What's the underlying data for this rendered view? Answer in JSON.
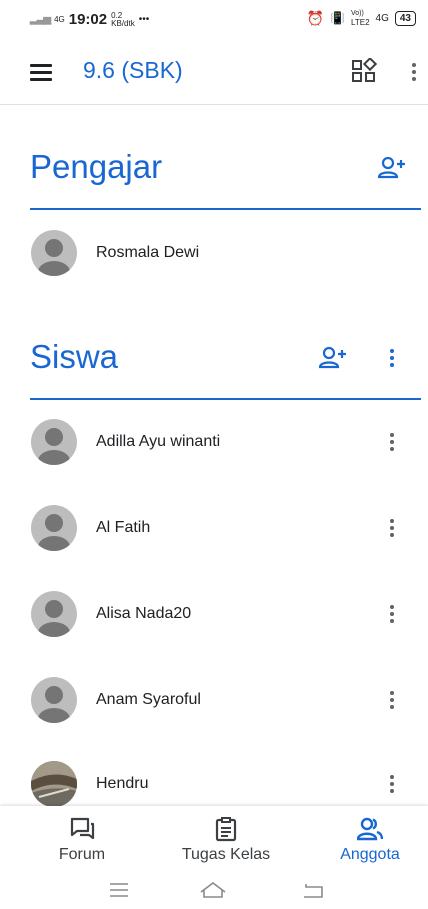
{
  "status_bar": {
    "network_type": "4G",
    "time": "19:02",
    "speed_value": "0.2",
    "speed_unit": "KB/dtk",
    "dots": "•••",
    "volte": "Vo))",
    "lte": "LTE2",
    "network2": "4G",
    "battery": "43"
  },
  "appbar": {
    "title": "9.6 (SBK)"
  },
  "teachers_section": {
    "title": "Pengajar",
    "people": [
      {
        "name": "Rosmala Dewi"
      }
    ]
  },
  "students_section": {
    "title": "Siswa",
    "people": [
      {
        "name": "Adilla Ayu winanti"
      },
      {
        "name": "Al Fatih"
      },
      {
        "name": "Alisa Nada20"
      },
      {
        "name": "Anam Syaroful"
      },
      {
        "name": "Hendru"
      }
    ]
  },
  "bottom_nav": {
    "items": [
      {
        "label": "Forum",
        "icon": "forum-icon",
        "active": false
      },
      {
        "label": "Tugas Kelas",
        "icon": "classwork-icon",
        "active": false
      },
      {
        "label": "Anggota",
        "icon": "people-icon",
        "active": true
      }
    ]
  },
  "colors": {
    "accent": "#1967d2",
    "text": "#202124",
    "icon_grey": "#5f6368",
    "divider": "#e0e0e0"
  }
}
